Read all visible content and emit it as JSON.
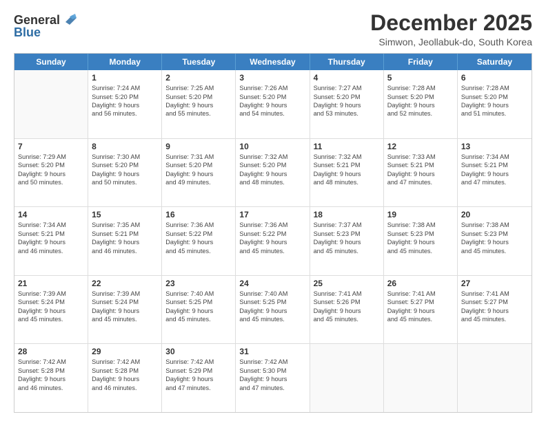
{
  "logo": {
    "general": "General",
    "blue": "Blue",
    "icon_color": "#2e6da4"
  },
  "title": "December 2025",
  "subtitle": "Simwon, Jeollabuk-do, South Korea",
  "header_days": [
    "Sunday",
    "Monday",
    "Tuesday",
    "Wednesday",
    "Thursday",
    "Friday",
    "Saturday"
  ],
  "weeks": [
    [
      {
        "day": "",
        "lines": []
      },
      {
        "day": "1",
        "lines": [
          "Sunrise: 7:24 AM",
          "Sunset: 5:20 PM",
          "Daylight: 9 hours",
          "and 56 minutes."
        ]
      },
      {
        "day": "2",
        "lines": [
          "Sunrise: 7:25 AM",
          "Sunset: 5:20 PM",
          "Daylight: 9 hours",
          "and 55 minutes."
        ]
      },
      {
        "day": "3",
        "lines": [
          "Sunrise: 7:26 AM",
          "Sunset: 5:20 PM",
          "Daylight: 9 hours",
          "and 54 minutes."
        ]
      },
      {
        "day": "4",
        "lines": [
          "Sunrise: 7:27 AM",
          "Sunset: 5:20 PM",
          "Daylight: 9 hours",
          "and 53 minutes."
        ]
      },
      {
        "day": "5",
        "lines": [
          "Sunrise: 7:28 AM",
          "Sunset: 5:20 PM",
          "Daylight: 9 hours",
          "and 52 minutes."
        ]
      },
      {
        "day": "6",
        "lines": [
          "Sunrise: 7:28 AM",
          "Sunset: 5:20 PM",
          "Daylight: 9 hours",
          "and 51 minutes."
        ]
      }
    ],
    [
      {
        "day": "7",
        "lines": [
          "Sunrise: 7:29 AM",
          "Sunset: 5:20 PM",
          "Daylight: 9 hours",
          "and 50 minutes."
        ]
      },
      {
        "day": "8",
        "lines": [
          "Sunrise: 7:30 AM",
          "Sunset: 5:20 PM",
          "Daylight: 9 hours",
          "and 50 minutes."
        ]
      },
      {
        "day": "9",
        "lines": [
          "Sunrise: 7:31 AM",
          "Sunset: 5:20 PM",
          "Daylight: 9 hours",
          "and 49 minutes."
        ]
      },
      {
        "day": "10",
        "lines": [
          "Sunrise: 7:32 AM",
          "Sunset: 5:20 PM",
          "Daylight: 9 hours",
          "and 48 minutes."
        ]
      },
      {
        "day": "11",
        "lines": [
          "Sunrise: 7:32 AM",
          "Sunset: 5:21 PM",
          "Daylight: 9 hours",
          "and 48 minutes."
        ]
      },
      {
        "day": "12",
        "lines": [
          "Sunrise: 7:33 AM",
          "Sunset: 5:21 PM",
          "Daylight: 9 hours",
          "and 47 minutes."
        ]
      },
      {
        "day": "13",
        "lines": [
          "Sunrise: 7:34 AM",
          "Sunset: 5:21 PM",
          "Daylight: 9 hours",
          "and 47 minutes."
        ]
      }
    ],
    [
      {
        "day": "14",
        "lines": [
          "Sunrise: 7:34 AM",
          "Sunset: 5:21 PM",
          "Daylight: 9 hours",
          "and 46 minutes."
        ]
      },
      {
        "day": "15",
        "lines": [
          "Sunrise: 7:35 AM",
          "Sunset: 5:21 PM",
          "Daylight: 9 hours",
          "and 46 minutes."
        ]
      },
      {
        "day": "16",
        "lines": [
          "Sunrise: 7:36 AM",
          "Sunset: 5:22 PM",
          "Daylight: 9 hours",
          "and 45 minutes."
        ]
      },
      {
        "day": "17",
        "lines": [
          "Sunrise: 7:36 AM",
          "Sunset: 5:22 PM",
          "Daylight: 9 hours",
          "and 45 minutes."
        ]
      },
      {
        "day": "18",
        "lines": [
          "Sunrise: 7:37 AM",
          "Sunset: 5:23 PM",
          "Daylight: 9 hours",
          "and 45 minutes."
        ]
      },
      {
        "day": "19",
        "lines": [
          "Sunrise: 7:38 AM",
          "Sunset: 5:23 PM",
          "Daylight: 9 hours",
          "and 45 minutes."
        ]
      },
      {
        "day": "20",
        "lines": [
          "Sunrise: 7:38 AM",
          "Sunset: 5:23 PM",
          "Daylight: 9 hours",
          "and 45 minutes."
        ]
      }
    ],
    [
      {
        "day": "21",
        "lines": [
          "Sunrise: 7:39 AM",
          "Sunset: 5:24 PM",
          "Daylight: 9 hours",
          "and 45 minutes."
        ]
      },
      {
        "day": "22",
        "lines": [
          "Sunrise: 7:39 AM",
          "Sunset: 5:24 PM",
          "Daylight: 9 hours",
          "and 45 minutes."
        ]
      },
      {
        "day": "23",
        "lines": [
          "Sunrise: 7:40 AM",
          "Sunset: 5:25 PM",
          "Daylight: 9 hours",
          "and 45 minutes."
        ]
      },
      {
        "day": "24",
        "lines": [
          "Sunrise: 7:40 AM",
          "Sunset: 5:25 PM",
          "Daylight: 9 hours",
          "and 45 minutes."
        ]
      },
      {
        "day": "25",
        "lines": [
          "Sunrise: 7:41 AM",
          "Sunset: 5:26 PM",
          "Daylight: 9 hours",
          "and 45 minutes."
        ]
      },
      {
        "day": "26",
        "lines": [
          "Sunrise: 7:41 AM",
          "Sunset: 5:27 PM",
          "Daylight: 9 hours",
          "and 45 minutes."
        ]
      },
      {
        "day": "27",
        "lines": [
          "Sunrise: 7:41 AM",
          "Sunset: 5:27 PM",
          "Daylight: 9 hours",
          "and 45 minutes."
        ]
      }
    ],
    [
      {
        "day": "28",
        "lines": [
          "Sunrise: 7:42 AM",
          "Sunset: 5:28 PM",
          "Daylight: 9 hours",
          "and 46 minutes."
        ]
      },
      {
        "day": "29",
        "lines": [
          "Sunrise: 7:42 AM",
          "Sunset: 5:28 PM",
          "Daylight: 9 hours",
          "and 46 minutes."
        ]
      },
      {
        "day": "30",
        "lines": [
          "Sunrise: 7:42 AM",
          "Sunset: 5:29 PM",
          "Daylight: 9 hours",
          "and 47 minutes."
        ]
      },
      {
        "day": "31",
        "lines": [
          "Sunrise: 7:42 AM",
          "Sunset: 5:30 PM",
          "Daylight: 9 hours",
          "and 47 minutes."
        ]
      },
      {
        "day": "",
        "lines": []
      },
      {
        "day": "",
        "lines": []
      },
      {
        "day": "",
        "lines": []
      }
    ]
  ]
}
